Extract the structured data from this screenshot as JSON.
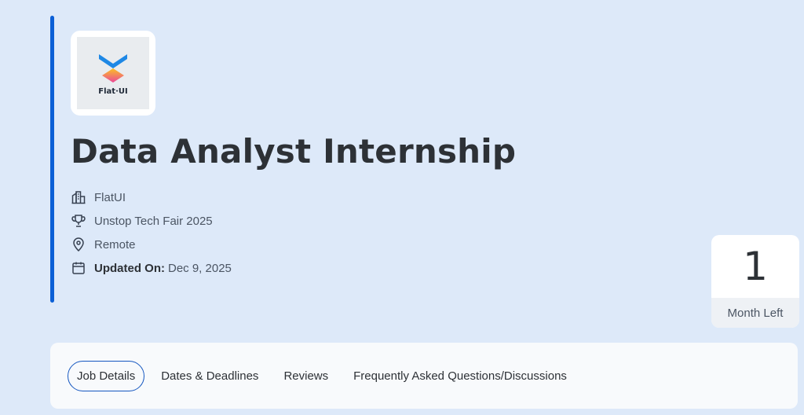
{
  "logo": {
    "brand_text": "Flat·UI"
  },
  "job": {
    "title": "Data Analyst Internship",
    "company": "FlatUI",
    "event": "Unstop Tech Fair 2025",
    "location": "Remote",
    "updated_label": "Updated On:",
    "updated_date": "Dec 9, 2025"
  },
  "countdown": {
    "value": "1",
    "label": "Month Left"
  },
  "tabs": [
    {
      "label": "Job Details",
      "active": true
    },
    {
      "label": "Dates & Deadlines",
      "active": false
    },
    {
      "label": "Reviews",
      "active": false
    },
    {
      "label": "Frequently Asked Questions/Discussions",
      "active": false
    }
  ],
  "colors": {
    "accent": "#0b5fd6",
    "background": "#dde9f9",
    "tab_active_border": "#1557c0"
  },
  "icons": [
    "building-icon",
    "trophy-icon",
    "location-pin-icon",
    "calendar-icon"
  ]
}
